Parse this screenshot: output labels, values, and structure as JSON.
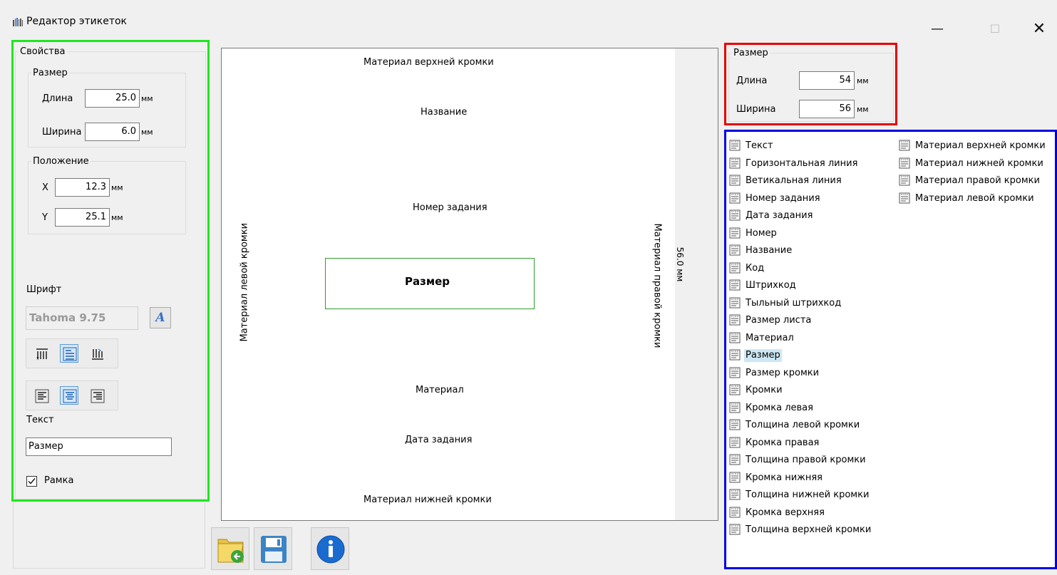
{
  "window": {
    "title": "Редактор этикеток"
  },
  "left": {
    "properties_legend": "Свойства",
    "size_legend": "Размер",
    "length_label": "Длина",
    "length_value": "25.0",
    "width_label": "Ширина",
    "width_value": "6.0",
    "unit_mm": "мм",
    "position_legend": "Положение",
    "x_label": "X",
    "x_value": "12.3",
    "y_label": "Y",
    "y_value": "25.1",
    "font_label": "Шрифт",
    "font_value": "Tahoma  9.75",
    "text_label": "Текст",
    "text_value": "Размер",
    "frame_label": "Рамка",
    "frame_checked": true
  },
  "canvas": {
    "top_edge": "Материал верхней кромки",
    "name": "Название",
    "task_number": "Номер задания",
    "selected_field": "Размер",
    "material": "Материал",
    "task_date": "Дата задания",
    "bottom_edge": "Материал нижней кромки",
    "left_edge": "Материал левой кромки",
    "right_edge": "Материал правой кромки",
    "height_dim": "56.0 мм"
  },
  "right": {
    "size_legend": "Размер",
    "length_label": "Длина",
    "length_value": "54",
    "width_label": "Ширина",
    "width_value": "56",
    "unit_mm": "мм",
    "fields_col1": [
      "Текст",
      "Горизонтальная линия",
      "Ветикальная линия",
      "Номер задания",
      "Дата задания",
      "Номер",
      "Название",
      "Код",
      "Штрихкод",
      "Тыльный штрихкод",
      "Размер листа",
      "Материал",
      "Размер",
      "Размер кромки",
      "Кромки",
      "Кромка левая",
      "Толщина левой кромки",
      "Кромка правая",
      "Толщина правой кромки",
      "Кромка нижняя",
      "Толщина нижней кромки",
      "Кромка верхняя",
      "Толщина верхней кромки"
    ],
    "fields_col2": [
      "Материал верхней кромки",
      "Материал нижней кромки",
      "Материал правой кромки",
      "Материал левой кромки"
    ],
    "selected_field": "Размер"
  },
  "colors": {
    "left_highlight": "#1ee61e",
    "size_highlight": "#e60000",
    "list_highlight": "#0000e6",
    "selection": "#cde8f4"
  }
}
